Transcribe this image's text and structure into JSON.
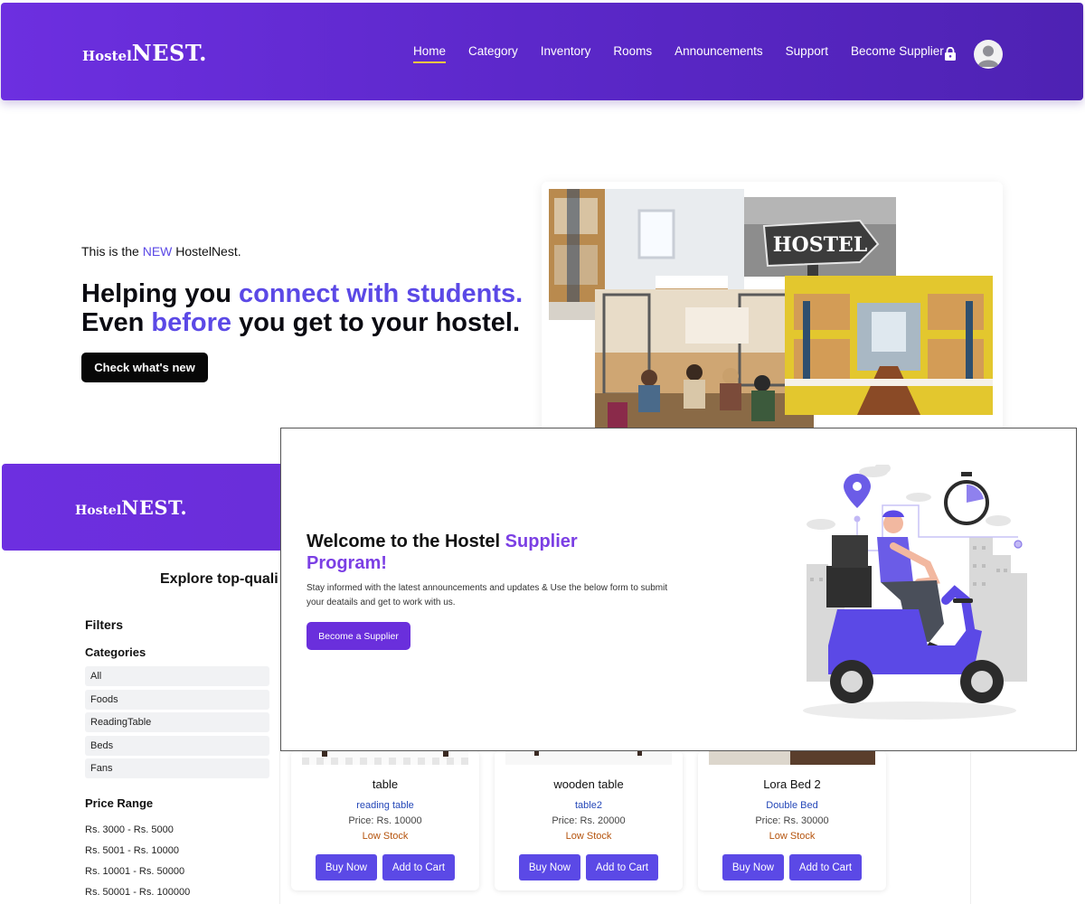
{
  "navbar": {
    "logo_small": "Hostel",
    "logo_big": "NEST.",
    "links": [
      {
        "label": "Home",
        "active": true
      },
      {
        "label": "Category"
      },
      {
        "label": "Inventory"
      },
      {
        "label": "Rooms"
      },
      {
        "label": "Announcements"
      },
      {
        "label": "Support"
      },
      {
        "label": "Become Supplier"
      }
    ],
    "cart_icon": "bag-lock-icon",
    "profile_icon": "user-avatar-icon"
  },
  "hero": {
    "intro_prefix": "This is the ",
    "intro_accent": "NEW",
    "intro_suffix": " HostelNest.",
    "line1_plain": "Helping you ",
    "line1_accent": "connect with students.",
    "line2_plain_a": "Even ",
    "line2_accent": "before",
    "line2_plain_b": " you get to your hostel.",
    "cta_label": "Check what's new",
    "collage_sign_text": "HOSTEL"
  },
  "background_page": {
    "logo_small": "Hostel",
    "logo_big": "NEST.",
    "explore_heading": "Explore top-quali",
    "filters_label": "Filters",
    "categories_label": "Categories",
    "categories": [
      "All",
      "Foods",
      "ReadingTable",
      "Beds",
      "Fans"
    ],
    "price_range_label": "Price Range",
    "price_ranges": [
      "Rs. 3000 - Rs. 5000",
      "Rs. 5001 - Rs. 10000",
      "Rs. 10001 - Rs. 50000",
      "Rs. 50001 - Rs. 100000"
    ],
    "products": [
      {
        "name": "table",
        "category": "reading table",
        "price": "Price: Rs. 10000",
        "stock": "Low Stock",
        "buy_label": "Buy Now",
        "cart_label": "Add to Cart"
      },
      {
        "name": "wooden table",
        "category": "table2",
        "price": "Price: Rs. 20000",
        "stock": "Low Stock",
        "buy_label": "Buy Now",
        "cart_label": "Add to Cart"
      },
      {
        "name": "Lora Bed 2",
        "category": "Double Bed",
        "price": "Price: Rs. 30000",
        "stock": "Low Stock",
        "buy_label": "Buy Now",
        "cart_label": "Add to Cart"
      }
    ]
  },
  "supplier_modal": {
    "title_plain": "Welcome to the Hostel ",
    "title_accent": "Supplier Program!",
    "description": "Stay informed with the latest announcements and updates & Use the below form to submit your deatails and get to work with us.",
    "button_label": "Become a Supplier",
    "illustration": "delivery-scooter-illustration"
  },
  "colors": {
    "brand_purple": "#6d2fe0",
    "accent_blue_violet": "#5b49e6",
    "nav_underline": "#f5c542",
    "stock_warning": "#b5530c"
  }
}
